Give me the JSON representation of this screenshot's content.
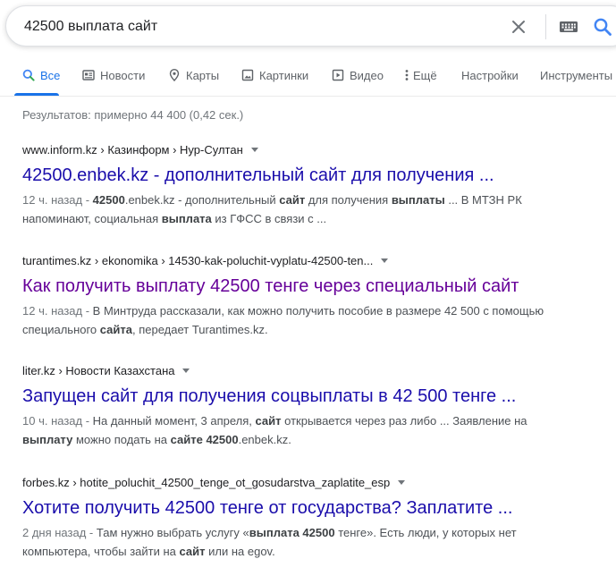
{
  "search": {
    "query": "42500 выплата сайт",
    "clear_icon": "close-icon",
    "keyboard_icon": "keyboard-icon",
    "search_icon": "search-icon"
  },
  "tabs": [
    {
      "label": "Все",
      "icon": "search-icon",
      "active": true
    },
    {
      "label": "Новости",
      "icon": "news-icon",
      "active": false
    },
    {
      "label": "Карты",
      "icon": "map-pin-icon",
      "active": false
    },
    {
      "label": "Картинки",
      "icon": "image-icon",
      "active": false
    },
    {
      "label": "Видео",
      "icon": "video-icon",
      "active": false
    },
    {
      "label": "Ещё",
      "icon": "more-vert-icon",
      "active": false
    },
    {
      "label": "Настройки",
      "active": false
    },
    {
      "label": "Инструменты",
      "active": false
    }
  ],
  "stats": "Результатов: примерно 44 400 (0,42 сек.)",
  "colors": {
    "link": "#1a0dab",
    "visited_link": "#660099",
    "accent": "#1a73e8",
    "snippet_text": "#4d5156",
    "meta_text": "#70757a"
  },
  "results": [
    {
      "cite": "www.inform.kz › Казинформ › Нур-Султан",
      "title": "42500.enbek.kz - дополнительный сайт для получения ...",
      "visited": false,
      "date": "12 ч. назад",
      "snippet_parts": [
        {
          "t": "42500",
          "b": true
        },
        {
          "t": ".enbek.kz - дополнительный ",
          "b": false
        },
        {
          "t": "сайт",
          "b": true
        },
        {
          "t": " для получения ",
          "b": false
        },
        {
          "t": "выплаты",
          "b": true
        },
        {
          "t": " ... В МТЗН РК напоминают, социальная ",
          "b": false
        },
        {
          "t": "выплата",
          "b": true
        },
        {
          "t": " из ГФСС в связи с ...",
          "b": false
        }
      ]
    },
    {
      "cite": "turantimes.kz › ekonomika › 14530-kak-poluchit-vyplatu-42500-ten...",
      "title": "Как получить выплату 42500 тенге через специальный сайт",
      "visited": true,
      "date": "12 ч. назад",
      "snippet_parts": [
        {
          "t": "В Минтруда рассказали, как можно получить пособие в размере 42 500 с помощью специального ",
          "b": false
        },
        {
          "t": "сайта",
          "b": true
        },
        {
          "t": ", передает Turantimes.kz.",
          "b": false
        }
      ]
    },
    {
      "cite": "liter.kz › Новости Казахстана",
      "title": "Запущен сайт для получения соцвыплаты в 42 500 тенге ...",
      "visited": false,
      "date": "10 ч. назад",
      "snippet_parts": [
        {
          "t": "На данный момент, 3 апреля, ",
          "b": false
        },
        {
          "t": "сайт",
          "b": true
        },
        {
          "t": " открывается через раз либо ... Заявление на ",
          "b": false
        },
        {
          "t": "выплату",
          "b": true
        },
        {
          "t": " можно подать на ",
          "b": false
        },
        {
          "t": "сайте",
          "b": true
        },
        {
          "t": " ",
          "b": false
        },
        {
          "t": "42500",
          "b": true
        },
        {
          "t": ".enbek.kz.",
          "b": false
        }
      ]
    },
    {
      "cite": "forbes.kz › hotite_poluchit_42500_tenge_ot_gosudarstva_zaplatite_esp",
      "title": "Хотите получить 42500 тенге от государства? Заплатите ...",
      "visited": false,
      "date": "2 дня назад",
      "snippet_parts": [
        {
          "t": "Там нужно выбрать услугу «",
          "b": false
        },
        {
          "t": "выплата 42500",
          "b": true
        },
        {
          "t": " тенге». Есть люди, у которых нет компьютера, чтобы зайти на ",
          "b": false
        },
        {
          "t": "сайт",
          "b": true
        },
        {
          "t": " или на egov.",
          "b": false
        }
      ]
    }
  ]
}
